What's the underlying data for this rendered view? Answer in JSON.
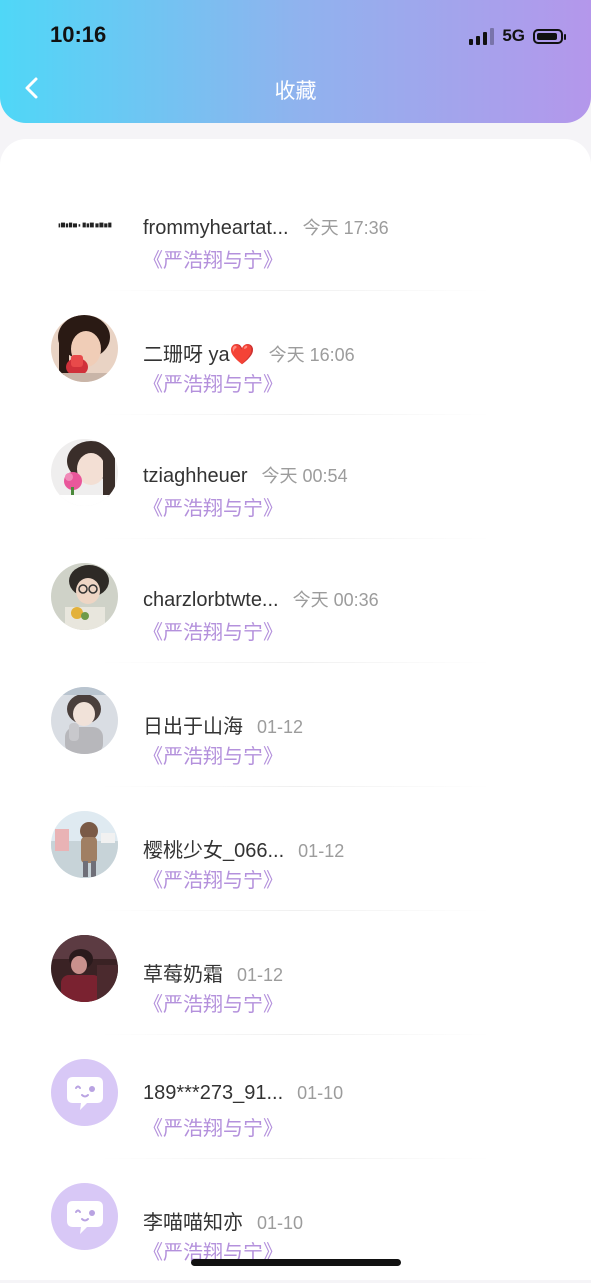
{
  "status": {
    "time": "10:16",
    "network": "5G"
  },
  "nav": {
    "title": "收藏"
  },
  "items": [
    {
      "name": "frommyheartat...",
      "time": "今天 17:36",
      "sub": "《严浩翔与宁》",
      "avatar": "text-logo"
    },
    {
      "name": "二珊呀 ya❤️",
      "time": "今天 16:06",
      "sub": "《严浩翔与宁》",
      "avatar": "photo"
    },
    {
      "name": "tziaghheuer",
      "time": "今天 00:54",
      "sub": "《严浩翔与宁》",
      "avatar": "photo"
    },
    {
      "name": "charzlorbtwte...",
      "time": "今天 00:36",
      "sub": "《严浩翔与宁》",
      "avatar": "photo"
    },
    {
      "name": "日出于山海",
      "time": "01-12",
      "sub": "《严浩翔与宁》",
      "avatar": "photo"
    },
    {
      "name": "樱桃少女_066...",
      "time": "01-12",
      "sub": "《严浩翔与宁》",
      "avatar": "photo"
    },
    {
      "name": "草莓奶霜",
      "time": "01-12",
      "sub": "《严浩翔与宁》",
      "avatar": "photo"
    },
    {
      "name": "189***273_91...",
      "time": "01-10",
      "sub": "《严浩翔与宁》",
      "avatar": "default-chat"
    },
    {
      "name": "李喵喵知亦",
      "time": "01-10",
      "sub": "《严浩翔与宁》",
      "avatar": "default-chat"
    }
  ]
}
